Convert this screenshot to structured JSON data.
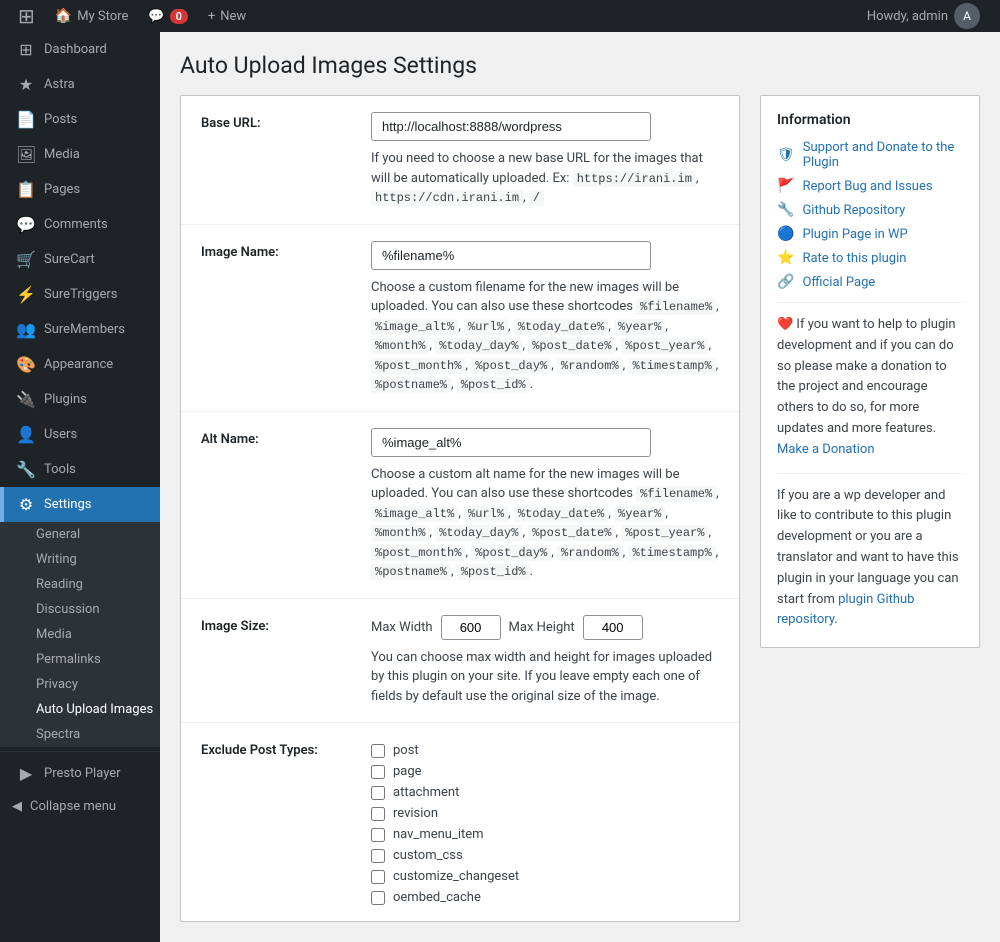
{
  "adminbar": {
    "logo": "W",
    "site_name": "My Store",
    "comment_icon": "💬",
    "comment_count": "0",
    "new_label": "New",
    "howdy": "Howdy, admin",
    "plus_icon": "+"
  },
  "sidebar": {
    "items": [
      {
        "id": "dashboard",
        "label": "Dashboard",
        "icon": "⊞"
      },
      {
        "id": "astra",
        "label": "Astra",
        "icon": "★"
      },
      {
        "id": "posts",
        "label": "Posts",
        "icon": "📄"
      },
      {
        "id": "media",
        "label": "Media",
        "icon": "🖼"
      },
      {
        "id": "pages",
        "label": "Pages",
        "icon": "📋"
      },
      {
        "id": "comments",
        "label": "Comments",
        "icon": "💬"
      },
      {
        "id": "surecart",
        "label": "SureCart",
        "icon": "🛒"
      },
      {
        "id": "suretriggers",
        "label": "SureTriggers",
        "icon": "⚡"
      },
      {
        "id": "suremembers",
        "label": "SureMembers",
        "icon": "👥"
      },
      {
        "id": "appearance",
        "label": "Appearance",
        "icon": "🎨"
      },
      {
        "id": "plugins",
        "label": "Plugins",
        "icon": "🔌"
      },
      {
        "id": "users",
        "label": "Users",
        "icon": "👤"
      },
      {
        "id": "tools",
        "label": "Tools",
        "icon": "🔧"
      },
      {
        "id": "settings",
        "label": "Settings",
        "icon": "⚙"
      }
    ],
    "settings_submenu": [
      {
        "id": "general",
        "label": "General"
      },
      {
        "id": "writing",
        "label": "Writing"
      },
      {
        "id": "reading",
        "label": "Reading"
      },
      {
        "id": "discussion",
        "label": "Discussion"
      },
      {
        "id": "media",
        "label": "Media"
      },
      {
        "id": "permalinks",
        "label": "Permalinks"
      },
      {
        "id": "privacy",
        "label": "Privacy"
      },
      {
        "id": "auto-upload-images",
        "label": "Auto Upload Images"
      },
      {
        "id": "spectra",
        "label": "Spectra"
      }
    ],
    "presto_player": "Presto Player",
    "collapse_menu": "Collapse menu"
  },
  "page": {
    "title": "Auto Upload Images Settings"
  },
  "form": {
    "base_url": {
      "label": "Base URL:",
      "value": "http://localhost:8888/wordpress",
      "description": "If you need to choose a new base URL for the images that will be automatically uploaded. Ex:",
      "examples": [
        "https://irani.im",
        "https://cdn.irani.im",
        "/"
      ]
    },
    "image_name": {
      "label": "Image Name:",
      "value": "%filename%",
      "description": "Choose a custom filename for the new images will be uploaded. You can also use these shortcodes",
      "shortcodes": [
        "%filename%",
        "%image_alt%",
        "%url%",
        "%today_date%",
        "%year%",
        "%month%",
        "%today_day%",
        "%post_date%",
        "%post_year%",
        "%post_month%",
        "%post_day%",
        "%random%",
        "%timestamp%",
        "%postname%",
        "%post_id%"
      ]
    },
    "alt_name": {
      "label": "Alt Name:",
      "value": "%image_alt%",
      "description": "Choose a custom alt name for the new images will be uploaded. You can also use these shortcodes",
      "shortcodes": [
        "%filename%",
        "%image_alt%",
        "%url%",
        "%today_date%",
        "%year%",
        "%month%",
        "%today_day%",
        "%post_date%",
        "%post_year%",
        "%post_month%",
        "%post_day%",
        "%random%",
        "%timestamp%",
        "%postname%",
        "%post_id%"
      ]
    },
    "image_size": {
      "label": "Image Size:",
      "max_width_label": "Max Width",
      "max_width_value": "600",
      "max_height_label": "Max Height",
      "max_height_value": "400",
      "description": "You can choose max width and height for images uploaded by this plugin on your site. If you leave empty each one of fields by default use the original size of the image."
    },
    "exclude_post_types": {
      "label": "Exclude Post Types:",
      "types": [
        "post",
        "page",
        "attachment",
        "revision",
        "nav_menu_item",
        "custom_css",
        "customize_changeset",
        "oembed_cache"
      ]
    }
  },
  "info": {
    "title": "Information",
    "links": [
      {
        "id": "support",
        "label": "Support and Donate to the Plugin",
        "icon": "🛡"
      },
      {
        "id": "report-bug",
        "label": "Report Bug and Issues",
        "icon": "🚩"
      },
      {
        "id": "github",
        "label": "Github Repository",
        "icon": "🔧"
      },
      {
        "id": "plugin-page",
        "label": "Plugin Page in WP",
        "icon": "🔵"
      },
      {
        "id": "rate",
        "label": "Rate to this plugin",
        "icon": "⭐"
      },
      {
        "id": "official",
        "label": "Official Page",
        "icon": "🔗"
      }
    ],
    "donation_text": "If you want to help to plugin development and if you can do so please make a donation to the project and encourage others to do so, for more updates and more features.",
    "donation_link": "Make a Donation",
    "developer_text": "If you are a wp developer and like to contribute to this plugin development or you are a translator and want to have this plugin in your language you can start from",
    "developer_link": "plugin Github repository",
    "heart": "❤️"
  }
}
